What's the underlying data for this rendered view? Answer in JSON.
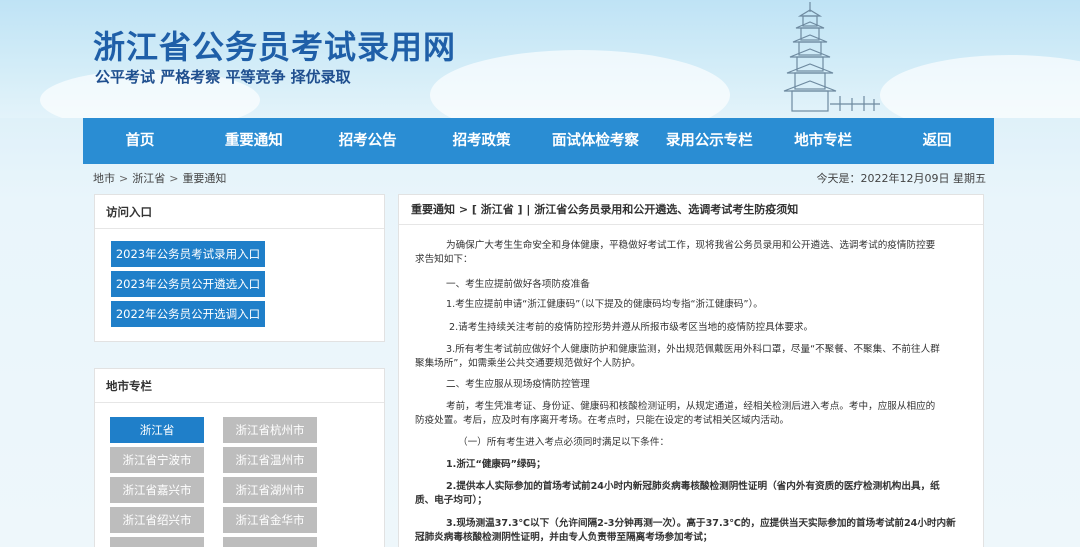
{
  "site": {
    "title": "浙江省公务员考试录用网",
    "slogan": "公平考试 严格考察 平等竞争 择优录取"
  },
  "nav": [
    "首页",
    "重要通知",
    "招考公告",
    "招考政策",
    "面试体检考察",
    "录用公示专栏",
    "地市专栏",
    "返回"
  ],
  "breadcrumb": {
    "items": [
      "地市",
      "浙江省",
      "重要通知"
    ],
    "separator": ">",
    "date_label": "今天是：2022年12月09日 星期五"
  },
  "sidebar": {
    "entry_title": "访问入口",
    "entries": [
      "2023年公务员考试录用入口",
      "2023年公务员公开遴选入口",
      "2022年公务员公开选调入口"
    ],
    "city_title": "地市专栏",
    "cities": [
      "浙江省",
      "浙江省杭州市",
      "浙江省宁波市",
      "浙江省温州市",
      "浙江省嘉兴市",
      "浙江省湖州市",
      "浙江省绍兴市",
      "浙江省金华市"
    ],
    "active_city": "浙江省"
  },
  "article": {
    "header": "重要通知 > [ 浙江省 ] | 浙江省公务员录用和公开遴选、选调考试考生防疫须知",
    "paragraphs": [
      "为确保广大考生生命安全和身体健康，平稳做好考试工作，现将我省公务员录用和公开遴选、选调考试的疫情防控要",
      "求告知如下：",
      "一、考生应提前做好各项防疫准备",
      "1.考生应提前申请“浙江健康码”（以下提及的健康码均专指“浙江健康码”）。",
      "2.请考生持续关注考前的疫情防控形势并遵从所报市级考区当地的疫情防控具体要求。",
      "3.所有考生考试前应做好个人健康防护和健康监测，外出规范佩戴医用外科口罩，尽量“不聚餐、不聚集、不前往人群",
      "聚集场所”，如需乘坐公共交通要规范做好个人防护。",
      "二、考生应服从现场疫情防控管理",
      "考前，考生凭准考证、身份证、健康码和核酸检测证明，从规定通道，经相关检测后进入考点。考中，应服从相应的",
      "防疫处置。考后，应及时有序离开考场。在考点时，只能在设定的考试相关区域内活动。",
      "（一）所有考生进入考点必须同时满足以下条件：",
      "1.浙江“健康码”绿码；",
      "2.提供本人实际参加的首场考试前24小时内新冠肺炎病毒核酸检测阴性证明（省内外有资质的医疗检测机构出具，纸",
      "质、电子均可）；",
      "3.现场测温37.3℃以下（允许间隔2-3分钟再测一次）。高于37.3℃的，应提供当天实际参加的首场考试前24小时内新",
      "冠肺炎病毒核酸检测阴性证明，并由专人负责带至隔离考场参加考试；"
    ]
  },
  "colors": {
    "nav_bg": "#2a8dd3",
    "title_blue": "#1f5fa8",
    "button_blue": "#1f7fc9",
    "button_gray": "#bdbdbd"
  }
}
